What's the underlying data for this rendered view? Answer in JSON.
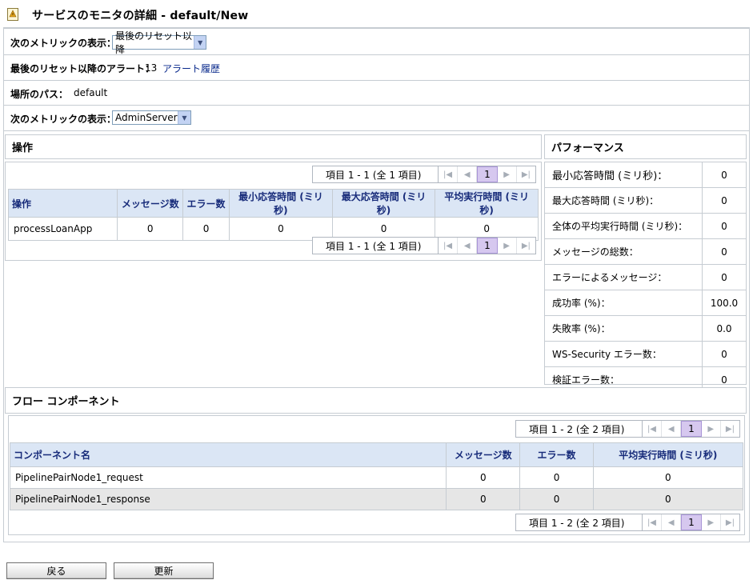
{
  "page": {
    "title": "サービスのモニタの詳細 - default/New"
  },
  "settings": {
    "metric_label_1": "次のメトリックの表示：",
    "metric_value_1": "最後のリセット以降",
    "alerts_label": "最後のリセット以降のアラート：",
    "alerts_count": "13",
    "alerts_link": "アラート履歴",
    "location_label": "場所のパス：",
    "location_value": "default",
    "metric_label_2": "次のメトリックの表示：",
    "metric_value_2": "AdminServer"
  },
  "operations": {
    "title": "操作",
    "pager_text": "項目 1 - 1 (全 1 項目)",
    "current_page": "1",
    "headers": [
      "操作",
      "メッセージ数",
      "エラー数",
      "最小応答時間 (ミリ秒)",
      "最大応答時間 (ミリ秒)",
      "平均実行時間 (ミリ秒)"
    ],
    "rows": [
      [
        "processLoanApp",
        "0",
        "0",
        "0",
        "0",
        "0"
      ]
    ]
  },
  "performance": {
    "title": "パフォーマンス",
    "items": [
      {
        "label": "最小応答時間 (ミリ秒)：",
        "value": "0"
      },
      {
        "label": "最大応答時間 (ミリ秒)：",
        "value": "0"
      },
      {
        "label": "全体の平均実行時間 (ミリ秒)：",
        "value": "0"
      },
      {
        "label": "メッセージの総数：",
        "value": "0"
      },
      {
        "label": "エラーによるメッセージ：",
        "value": "0"
      },
      {
        "label": "成功率 (%)：",
        "value": "100.0"
      },
      {
        "label": "失敗率 (%)：",
        "value": "0.0"
      },
      {
        "label": "WS-Security エラー数：",
        "value": "0"
      },
      {
        "label": "検証エラー数：",
        "value": "0"
      }
    ]
  },
  "flow": {
    "title": "フロー コンポーネント",
    "pager_text": "項目 1 - 2 (全 2 項目)",
    "current_page": "1",
    "headers": [
      "コンポーネント名",
      "メッセージ数",
      "エラー数",
      "平均実行時間 (ミリ秒)"
    ],
    "rows": [
      [
        "PipelinePairNode1_request",
        "0",
        "0",
        "0"
      ],
      [
        "PipelinePairNode1_response",
        "0",
        "0",
        "0"
      ]
    ]
  },
  "buttons": {
    "back": "戻る",
    "refresh": "更新"
  },
  "colors": {
    "header_bg": "#dbe6f5",
    "header_text": "#172b7a",
    "link": "#0a2a8c",
    "pager_current": "#d6c8ef",
    "alt_row": "#e6e6e6"
  }
}
